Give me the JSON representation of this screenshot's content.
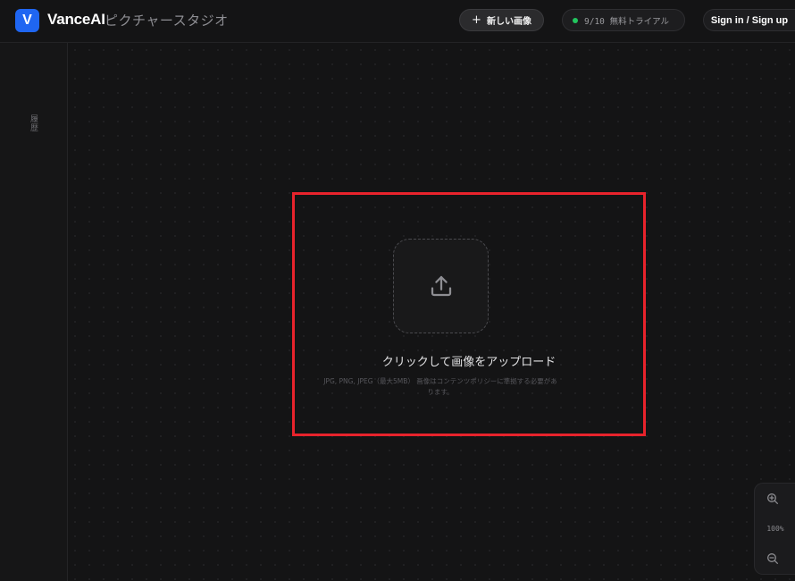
{
  "header": {
    "logo_letter": "V",
    "brand_name": "VanceAI",
    "brand_sub": "ピクチャースタジオ",
    "new_image": {
      "icon": "plus-icon",
      "label": "新しい画像"
    },
    "trial": {
      "status_color": "#22c55e",
      "label": "9/10 無料トライアル"
    },
    "sign_in_label": "Sign in / Sign up"
  },
  "sidebar": {
    "history_label": "履歴"
  },
  "upload": {
    "icon": "upload-icon",
    "title": "クリックして画像をアップロード",
    "note": "JPG, PNG, JPEG（最大5MB） 画像はコンテンツポリシーに準拠する必要があります。"
  },
  "zoom": {
    "zoom_in_icon": "zoom-in-icon",
    "level": "100%",
    "zoom_out_icon": "zoom-out-icon"
  },
  "colors": {
    "accent": "#1f66f2",
    "highlight": "#e8232c",
    "background": "#141415"
  }
}
